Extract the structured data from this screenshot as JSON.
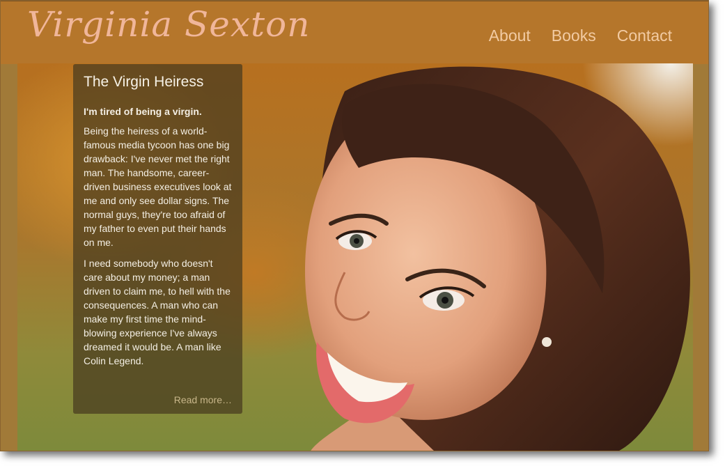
{
  "header": {
    "logo": "Virginia Sexton",
    "nav": [
      {
        "label": "About"
      },
      {
        "label": "Books"
      },
      {
        "label": "Contact"
      }
    ]
  },
  "feature": {
    "title": "The Virgin Heiress",
    "lead": "I'm tired of being a virgin.",
    "paragraphs": [
      "Being the heiress of a world-famous media tycoon has one big drawback: I've never met the right man. The handsome, career-driven business executives look at me and only see dollar signs. The normal guys, they're too afraid of my father to even put their hands on me.",
      "I need somebody who doesn't care about my money; a man driven to claim me, to hell with the consequences. A man who can make my first time the mind-blowing experience I've always dreamed it would be. A man like Colin Legend."
    ],
    "read_more": "Read more…"
  },
  "colors": {
    "header_bg": "#b5762b",
    "logo": "#f0b69a",
    "nav": "#f2cba3",
    "card_bg": "#463a1e",
    "read_more": "#c8b68a"
  }
}
